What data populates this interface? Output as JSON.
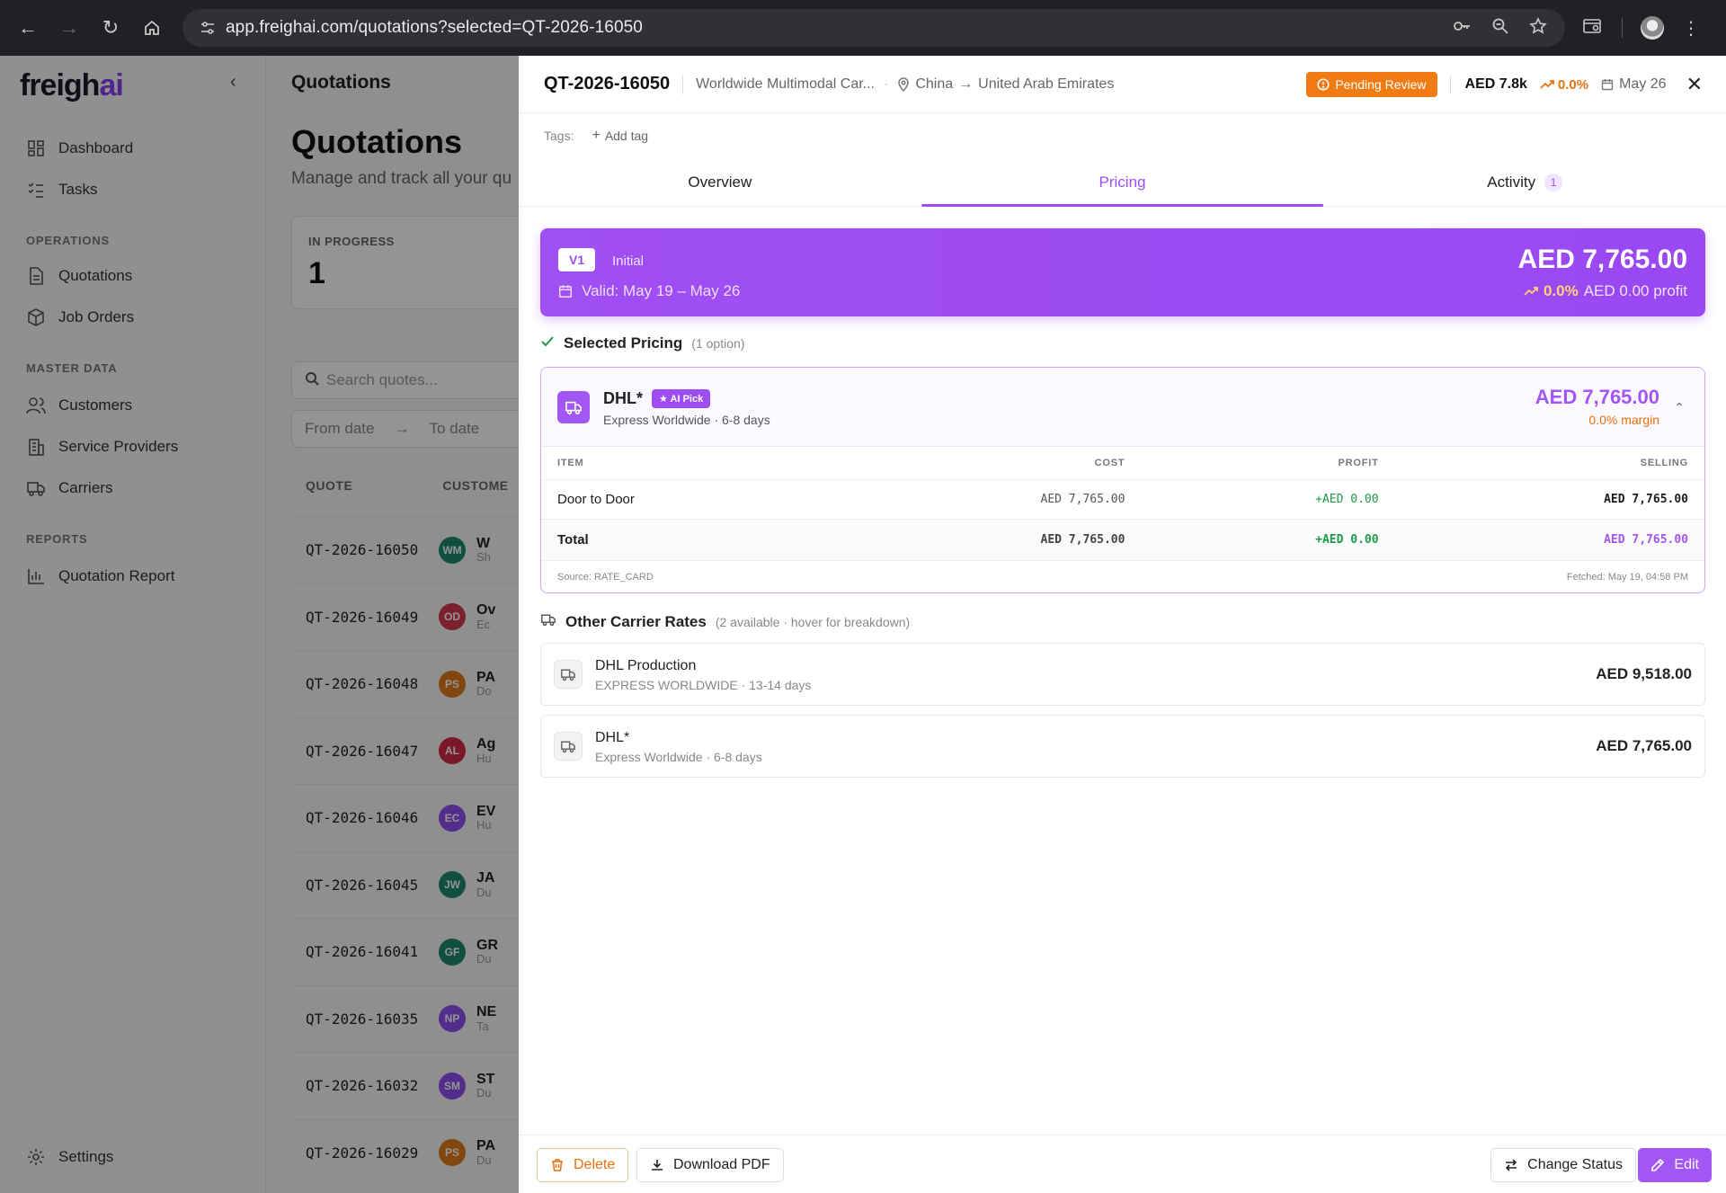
{
  "browser": {
    "url": "app.freighai.com/quotations?selected=QT-2026-16050"
  },
  "sidebar": {
    "logo_main": "freigh",
    "logo_accent": "ai",
    "items_top": [
      {
        "label": "Dashboard",
        "icon": "dashboard-icon"
      },
      {
        "label": "Tasks",
        "icon": "tasks-icon"
      }
    ],
    "section_operations": "OPERATIONS",
    "items_operations": [
      {
        "label": "Quotations",
        "icon": "document-icon"
      },
      {
        "label": "Job Orders",
        "icon": "box-icon"
      }
    ],
    "section_master": "MASTER DATA",
    "items_master": [
      {
        "label": "Customers",
        "icon": "users-icon"
      },
      {
        "label": "Service Providers",
        "icon": "building-icon"
      },
      {
        "label": "Carriers",
        "icon": "truck-icon"
      }
    ],
    "section_reports": "REPORTS",
    "items_reports": [
      {
        "label": "Quotation Report",
        "icon": "bar-chart-icon"
      }
    ],
    "settings_label": "Settings"
  },
  "main": {
    "crumb": "Quotations",
    "title": "Quotations",
    "subtitle": "Manage and track all your qu",
    "stat_label": "IN PROGRESS",
    "stat_value": "1",
    "search_placeholder": "Search quotes...",
    "from_date": "From date",
    "to_date": "To date",
    "col_quote": "QUOTE",
    "col_customer": "CUSTOME",
    "rows": [
      {
        "id": "QT-2026-16050",
        "initials": "WM",
        "color": "#1e8a6e",
        "name": "W",
        "sub": "Sh"
      },
      {
        "id": "QT-2026-16049",
        "initials": "OD",
        "color": "#d43a4f",
        "name": "Ov",
        "sub": "Ec"
      },
      {
        "id": "QT-2026-16048",
        "initials": "PS",
        "color": "#e07a1c",
        "name": "PA",
        "sub": "Do"
      },
      {
        "id": "QT-2026-16047",
        "initials": "AL",
        "color": "#d42a44",
        "name": "Ag",
        "sub": "Hu"
      },
      {
        "id": "QT-2026-16046",
        "initials": "EC",
        "color": "#8d4ff0",
        "name": "EV",
        "sub": "Hu"
      },
      {
        "id": "QT-2026-16045",
        "initials": "JW",
        "color": "#1e8a6e",
        "name": "JA",
        "sub": "Du"
      },
      {
        "id": "QT-2026-16041",
        "initials": "GF",
        "color": "#1e8a6e",
        "name": "GR",
        "sub": "Du"
      },
      {
        "id": "QT-2026-16035",
        "initials": "NP",
        "color": "#8d4ff0",
        "name": "NE",
        "sub": "Ta"
      },
      {
        "id": "QT-2026-16032",
        "initials": "SM",
        "color": "#8d4ff0",
        "name": "ST",
        "sub": "Du"
      },
      {
        "id": "QT-2026-16029",
        "initials": "PS",
        "color": "#e07a1c",
        "name": "PA",
        "sub": "Du"
      }
    ]
  },
  "drawer": {
    "quote_id": "QT-2026-16050",
    "customer": "Worldwide Multimodal Car...",
    "origin": "China",
    "destination": "United Arab Emirates",
    "status": "Pending Review",
    "amount_short": "AED 7.8k",
    "margin_pct": "0.0%",
    "date": "May 26",
    "tags_label": "Tags:",
    "add_tag": "Add tag",
    "tabs": [
      {
        "label": "Overview"
      },
      {
        "label": "Pricing"
      },
      {
        "label": "Activity",
        "badge": "1"
      }
    ],
    "version": {
      "label": "V1",
      "name": "Initial",
      "validity": "Valid: May 19 – May 26",
      "total": "AED 7,765.00",
      "margin": "0.0%",
      "profit": "AED 0.00 profit"
    },
    "selected": {
      "title": "Selected Pricing",
      "count": "(1 option)",
      "carrier": "DHL*",
      "ai_pick": "AI Pick",
      "service": "Express Worldwide · 6-8 days",
      "price": "AED 7,765.00",
      "margin": "0.0% margin",
      "columns": [
        "ITEM",
        "COST",
        "PROFIT",
        "SELLING"
      ],
      "line": {
        "item": "Door to Door",
        "cost": "AED 7,765.00",
        "profit": "+AED 0.00",
        "selling": "AED 7,765.00"
      },
      "total": {
        "item": "Total",
        "cost": "AED 7,765.00",
        "profit": "+AED 0.00",
        "selling": "AED 7,765.00"
      },
      "source": "Source: RATE_CARD",
      "fetched": "Fetched: May 19, 04:58 PM"
    },
    "other": {
      "title": "Other Carrier Rates",
      "note": "(2 available · hover for breakdown)",
      "rates": [
        {
          "name": "DHL Production",
          "sub": "EXPRESS WORLDWIDE · 13-14 days",
          "price": "AED 9,518.00"
        },
        {
          "name": "DHL*",
          "sub": "Express Worldwide · 6-8 days",
          "price": "AED 7,765.00"
        }
      ]
    },
    "footer": {
      "delete": "Delete",
      "download": "Download PDF",
      "change_status": "Change Status",
      "edit": "Edit"
    }
  },
  "colors": {
    "accent": "#a256f4",
    "warning": "#f07b12",
    "success": "#1f9a4b"
  }
}
